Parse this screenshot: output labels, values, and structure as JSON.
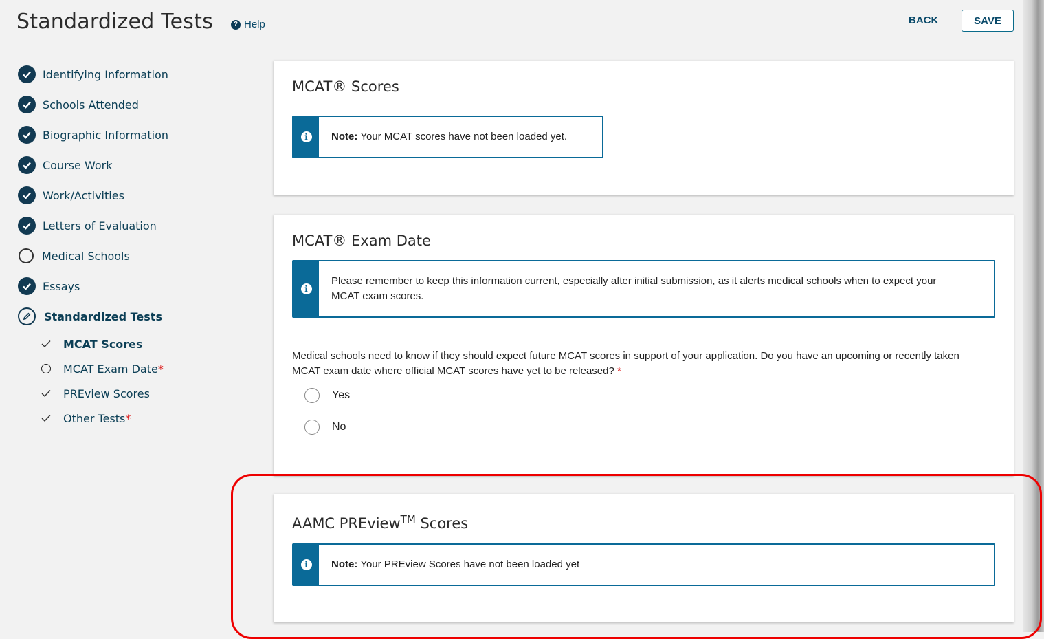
{
  "header": {
    "title": "Standardized Tests",
    "help_label": "Help",
    "back_label": "BACK",
    "save_label": "SAVE"
  },
  "sidebar": {
    "items": [
      {
        "label": "Identifying Information",
        "status": "complete"
      },
      {
        "label": "Schools Attended",
        "status": "complete"
      },
      {
        "label": "Biographic Information",
        "status": "complete"
      },
      {
        "label": "Course Work",
        "status": "complete"
      },
      {
        "label": "Work/Activities",
        "status": "complete"
      },
      {
        "label": "Letters of Evaluation",
        "status": "complete"
      },
      {
        "label": "Medical Schools",
        "status": "incomplete"
      },
      {
        "label": "Essays",
        "status": "complete"
      },
      {
        "label": "Standardized Tests",
        "status": "in-progress"
      }
    ],
    "subitems": [
      {
        "label": "MCAT Scores",
        "mark": "check",
        "required": false
      },
      {
        "label": "MCAT Exam Date",
        "mark": "circle",
        "required": true
      },
      {
        "label": "PREview Scores",
        "mark": "check",
        "required": false
      },
      {
        "label": "Other Tests",
        "mark": "check",
        "required": true
      }
    ],
    "required_mark": "*"
  },
  "mcat_scores": {
    "title": "MCAT® Scores",
    "note_label": "Note:",
    "note_text": "Your MCAT scores have not been loaded yet."
  },
  "mcat_exam_date": {
    "title": "MCAT® Exam Date",
    "info_text": "Please remember to keep this information current, especially after initial submission, as it alerts medical schools when to expect your MCAT exam scores.",
    "question": "Medical schools need to know if they should expect future MCAT scores in support of your application. Do you have an upcoming or recently taken MCAT exam date where official MCAT scores have yet to be released?",
    "required_mark": "*",
    "options": [
      "Yes",
      "No"
    ]
  },
  "preview_scores": {
    "title_main": "AAMC PREview",
    "title_sup": "TM",
    "title_end": " Scores",
    "note_label": "Note:",
    "note_text": "Your PREview Scores have not been loaded yet"
  },
  "colors": {
    "accent": "#0a6a98",
    "nav_text": "#0b3e55",
    "highlight": "#ee0000"
  }
}
